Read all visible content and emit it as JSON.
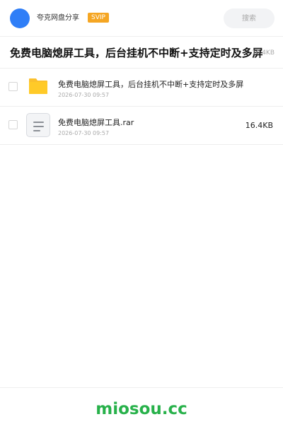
{
  "header": {
    "account_name": "夸克网盘分享",
    "svip_label": "SVIP",
    "search_placeholder": "搜索"
  },
  "share": {
    "title": "免费电脑熄屏工具，后台挂机不中断+支持定时及多屏",
    "total_size": "16.4KB"
  },
  "files": [
    {
      "type": "folder",
      "icon": "folder-icon",
      "name": "免费电脑熄屏工具，后台挂机不中断+支持定时及多屏",
      "date": "2026-07-30 09:57",
      "size": ""
    },
    {
      "type": "archive",
      "icon": "document-icon",
      "name": "免费电脑熄屏工具.rar",
      "date": "2026-07-30 09:57",
      "size": "16.4KB"
    }
  ],
  "footer": {
    "watermark": "miosou.cc"
  },
  "colors": {
    "avatar": "#2f7ef7",
    "svip": "#f5a623",
    "folder": "#fbc02d",
    "watermark": "#27b14a"
  }
}
